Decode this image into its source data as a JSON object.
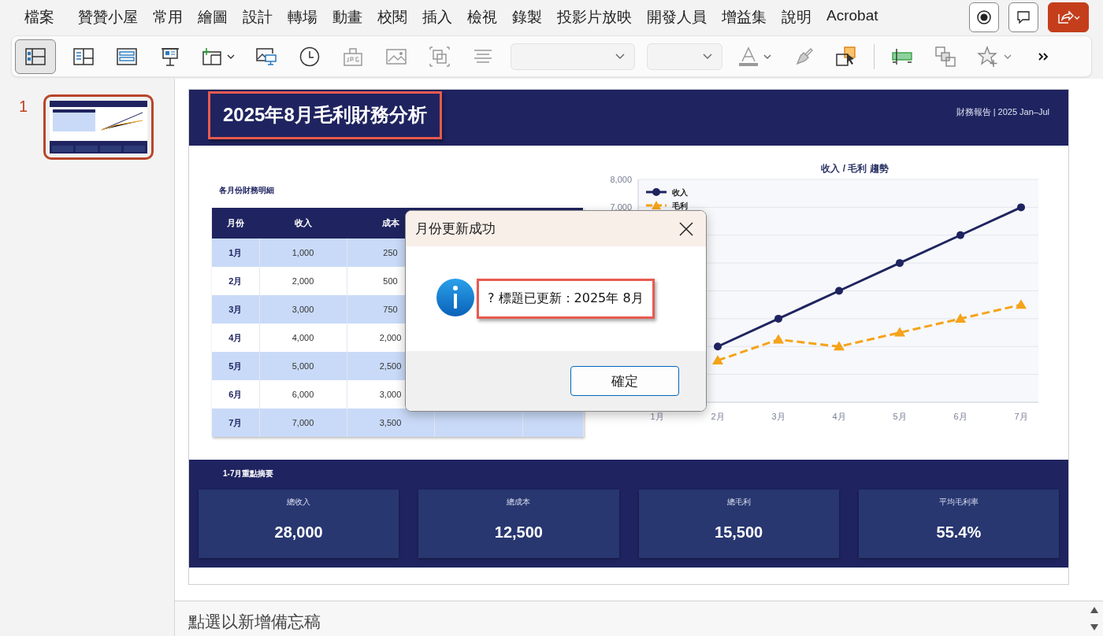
{
  "menu_bar": {
    "items": [
      "檔案",
      "贊贊小屋",
      "常用",
      "繪圖",
      "設計",
      "轉場",
      "動畫",
      "校閱",
      "插入",
      "檢視",
      "錄製",
      "投影片放映",
      "開發人員",
      "增益集",
      "說明",
      "Acrobat"
    ]
  },
  "toolbar": {
    "view_buttons": [
      {
        "selected": true
      },
      {
        "selected": false
      },
      {
        "selected": false
      }
    ]
  },
  "slide_panel": {
    "slides": [
      {
        "number": "1",
        "selected": true
      }
    ]
  },
  "slide": {
    "title": "2025年8月毛利財務分析",
    "subtitle": "財務報告 | 2025 Jan–Jul",
    "table": {
      "caption": "各月份財務明細",
      "columns": [
        "月份",
        "收入",
        "成本"
      ],
      "rows": [
        [
          "1月",
          "1,000",
          "250"
        ],
        [
          "2月",
          "2,000",
          "500"
        ],
        [
          "3月",
          "3,000",
          "750"
        ],
        [
          "4月",
          "4,000",
          "2,000"
        ],
        [
          "5月",
          "5,000",
          "2,500"
        ],
        [
          "6月",
          "6,000",
          "3,000"
        ],
        [
          "7月",
          "7,000",
          "3,500"
        ]
      ]
    },
    "chart": {
      "chart_data": {
        "type": "line",
        "title": "收入 / 毛利 趨勢",
        "categories": [
          "1月",
          "2月",
          "3月",
          "4月",
          "5月",
          "6月",
          "7月"
        ],
        "legend": true,
        "ylim": [
          0,
          8000
        ],
        "yticks": [
          {
            "value": 8000,
            "label": "8,000"
          },
          {
            "value": 7000,
            "label": "7,000"
          }
        ],
        "series": [
          {
            "name": "收入",
            "color": "#1f2460",
            "marker": "circle",
            "line_style": "solid",
            "values": [
              null,
              2000,
              3000,
              4000,
              5000,
              6000,
              7000
            ]
          },
          {
            "name": "毛利",
            "color": "#f5a31a",
            "marker": "triangle",
            "line_style": "dashed",
            "values": [
              null,
              1500,
              2250,
              2000,
              2500,
              3000,
              3500
            ]
          }
        ]
      }
    },
    "summary": {
      "title": "1-7月重點摘要",
      "cards": [
        {
          "label": "總收入",
          "value": "28,000"
        },
        {
          "label": "總成本",
          "value": "12,500"
        },
        {
          "label": "總毛利",
          "value": "15,500"
        },
        {
          "label": "平均毛利率",
          "value": "55.4%"
        }
      ]
    }
  },
  "dialog": {
    "title": "月份更新成功",
    "message": "? 標題已更新：2025年 8月",
    "buttons": [
      "確定"
    ]
  },
  "notes": {
    "placeholder": "點選以新增備忘稿"
  }
}
